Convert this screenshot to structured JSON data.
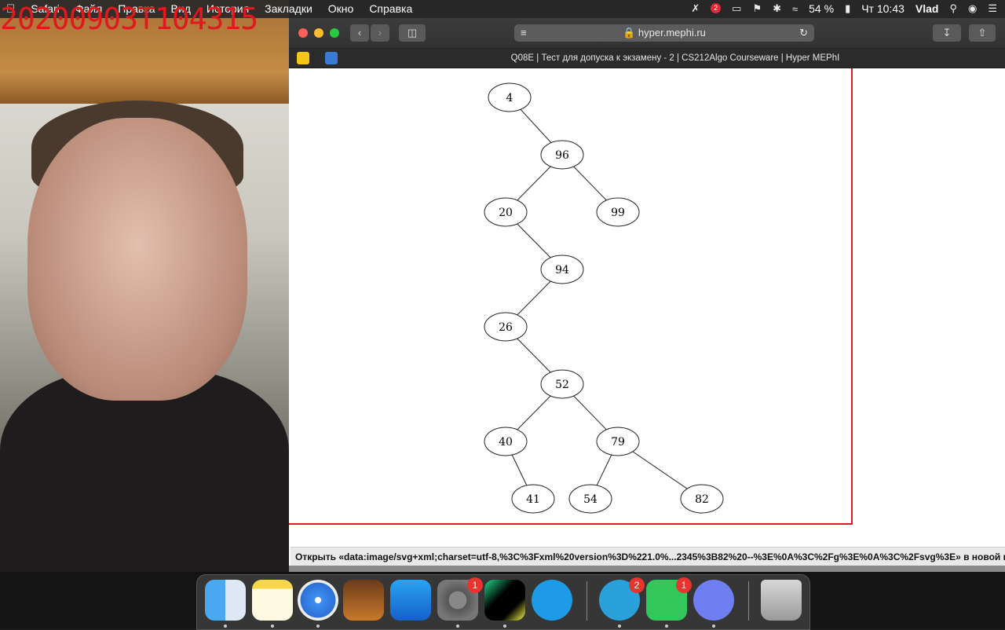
{
  "timestamp_overlay": "20200903T104315",
  "menubar": {
    "apple_icon": "apple-icon",
    "items": [
      "Safari",
      "Файл",
      "Правка",
      "Вид",
      "История",
      "Закладки",
      "Окно",
      "Справка"
    ],
    "battery": "54 %",
    "clock": "Чт 10:43",
    "user": "Vlad",
    "notification_badge": "2"
  },
  "safari": {
    "address": "hyper.mephi.ru",
    "tab_title": "Q08E | Тест для допуска к экзамену - 2 | CS212Algo Courseware | Hyper MEPhI",
    "status_link": "Открыть «data:image/svg+xml;charset=utf-8,%3C%3Fxml%20version%3D%221.0%...2345%3B82%20--%3E%0A%3C%2Fg%3E%0A%3C%2Fsvg%3E» в новой вкладке"
  },
  "tree": {
    "nodes": [
      "4",
      "96",
      "20",
      "99",
      "94",
      "26",
      "52",
      "40",
      "79",
      "41",
      "54",
      "82"
    ]
  },
  "dock": {
    "apps": [
      {
        "name": "Finder",
        "badge": ""
      },
      {
        "name": "Notes",
        "badge": ""
      },
      {
        "name": "Safari",
        "badge": ""
      },
      {
        "name": "GarageBand",
        "badge": ""
      },
      {
        "name": "Xcode",
        "badge": ""
      },
      {
        "name": "System Preferences",
        "badge": "1"
      },
      {
        "name": "PyCharm",
        "badge": ""
      },
      {
        "name": "Skype",
        "badge": ""
      },
      {
        "name": "Telegram",
        "badge": "2"
      },
      {
        "name": "FaceTime",
        "badge": "1"
      },
      {
        "name": "Discord",
        "badge": ""
      },
      {
        "name": "Trash",
        "badge": ""
      }
    ]
  }
}
